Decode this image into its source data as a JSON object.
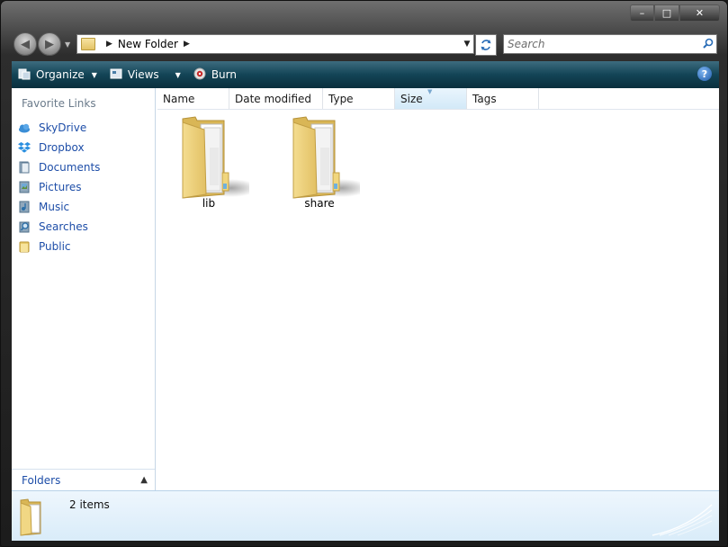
{
  "window": {
    "min_glyph": "–",
    "max_glyph": "□",
    "close_glyph": "✕"
  },
  "nav": {
    "back_glyph": "◀",
    "forward_glyph": "▶",
    "dropdown_glyph": "▼"
  },
  "address": {
    "path": "New Folder",
    "separator": "▶",
    "dropdown_glyph": "▼"
  },
  "search": {
    "placeholder": "Search"
  },
  "toolbar": {
    "organize": "Organize",
    "views": "Views",
    "burn": "Burn",
    "caret": "▼",
    "help": "?"
  },
  "sidebar": {
    "title": "Favorite Links",
    "items": [
      {
        "label": "SkyDrive",
        "icon": "cloud-icon"
      },
      {
        "label": "Dropbox",
        "icon": "dropbox-icon"
      },
      {
        "label": "Documents",
        "icon": "documents-icon"
      },
      {
        "label": "Pictures",
        "icon": "pictures-icon"
      },
      {
        "label": "Music",
        "icon": "music-icon"
      },
      {
        "label": "Searches",
        "icon": "search-icon"
      },
      {
        "label": "Public",
        "icon": "folder-icon"
      }
    ],
    "folders_label": "Folders",
    "folders_chevron": "▲"
  },
  "columns": [
    "Name",
    "Date modified",
    "Type",
    "Size",
    "Tags"
  ],
  "files": [
    {
      "name": "lib"
    },
    {
      "name": "share"
    }
  ],
  "status": {
    "count_text": "2 items"
  },
  "colors": {
    "link": "#1e4ea8",
    "toolbar": "#134456",
    "status_bg": "#d9ecf9"
  }
}
